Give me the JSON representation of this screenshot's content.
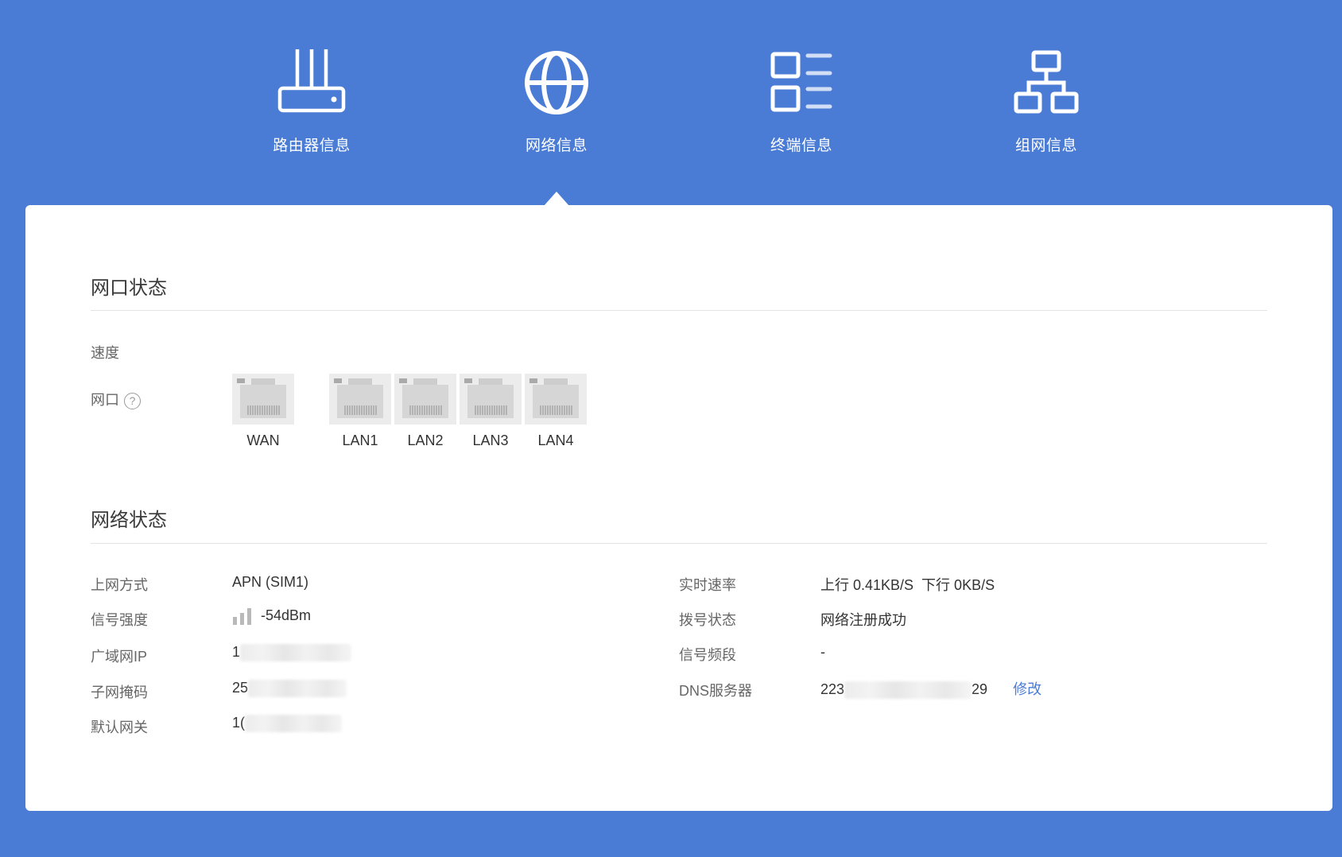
{
  "nav": {
    "items": [
      {
        "label": "路由器信息",
        "icon": "router-icon"
      },
      {
        "label": "网络信息",
        "icon": "globe-icon",
        "active": true
      },
      {
        "label": "终端信息",
        "icon": "device-list-icon"
      },
      {
        "label": "组网信息",
        "icon": "network-topology-icon"
      }
    ]
  },
  "port_status": {
    "title": "网口状态",
    "speed_label": "速度",
    "port_label": "网口",
    "help_symbol": "?",
    "ports": [
      "WAN",
      "LAN1",
      "LAN2",
      "LAN3",
      "LAN4"
    ]
  },
  "network_status": {
    "title": "网络状态",
    "left": {
      "access_mode": {
        "label": "上网方式",
        "value": "APN (SIM1)"
      },
      "signal": {
        "label": "信号强度",
        "value": "-54dBm",
        "bars": 3,
        "bars_total": 3
      },
      "wan_ip": {
        "label": "广域网IP",
        "value_prefix": "1"
      },
      "subnet": {
        "label": "子网掩码",
        "value_prefix": "25"
      },
      "gateway": {
        "label": "默认网关",
        "value_prefix": "1("
      }
    },
    "right": {
      "speed": {
        "label": "实时速率",
        "value": "上行 0.41KB/S  下行 0KB/S"
      },
      "dial": {
        "label": "拨号状态",
        "value": "网络注册成功"
      },
      "band": {
        "label": "信号频段",
        "value": "-"
      },
      "dns": {
        "label": "DNS服务器",
        "value_prefix": "223",
        "value_suffix": "29",
        "edit_label": "修改"
      }
    }
  },
  "colors": {
    "background": "#4a7bd5",
    "card": "#ffffff",
    "link": "#4a7bd5",
    "port": "#ececec"
  }
}
